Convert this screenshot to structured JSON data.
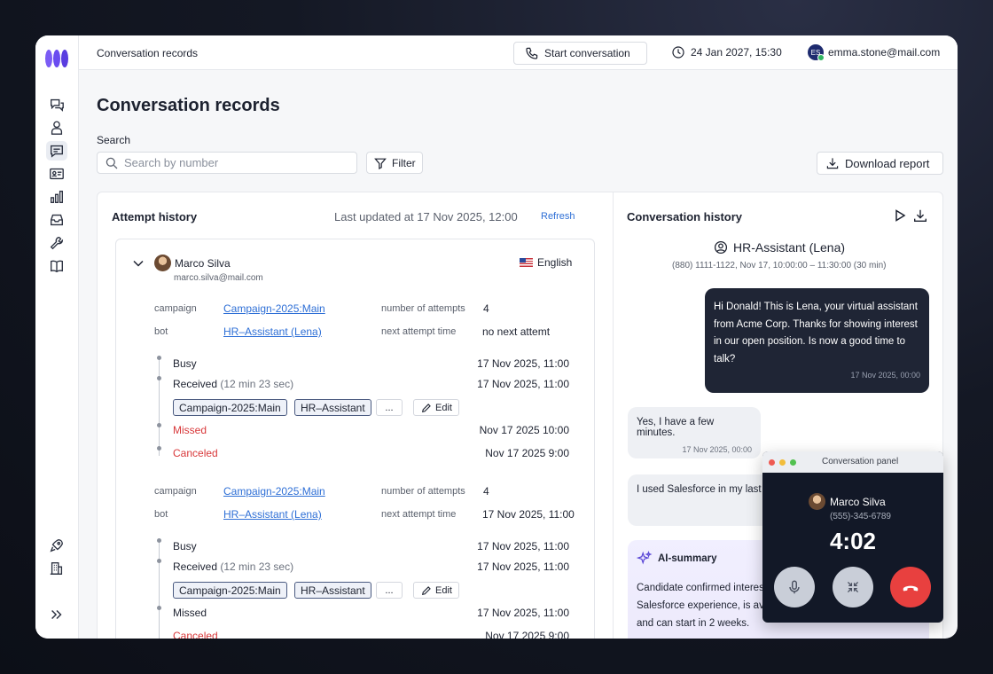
{
  "topbar": {
    "breadcrumb": "Conversation records",
    "start_conversation": "Start conversation",
    "datetime": "24 Jan 2027, 15:30",
    "user_initials": "ES",
    "user_email": "emma.stone@mail.com"
  },
  "page": {
    "title": "Conversation records",
    "search_label": "Search",
    "search_placeholder": "Search by number",
    "filter": "Filter",
    "download": "Download report"
  },
  "attempts": {
    "title": "Attempt history",
    "last_updated": "Last updated at 17 Nov 2025, 12:00",
    "refresh": "Refresh",
    "record": {
      "name": "Marco Silva",
      "email": "marco.silva@mail.com",
      "language": "English"
    },
    "labels": {
      "campaign": "campaign",
      "bot": "bot",
      "num_attempts": "number of attempts",
      "next_attempt": "next attempt time",
      "edit": "Edit",
      "more": "..."
    },
    "groups": [
      {
        "campaign": "Campaign-2025:Main",
        "bot": "HR–Assistant (Lena)",
        "attempts": "4",
        "next_attempt": "no next attemt",
        "events": [
          {
            "status": "Busy",
            "time": "17 Nov 2025, 11:00"
          },
          {
            "status": "Received",
            "duration": "(12 min 23 sec)",
            "time": "17 Nov 2025, 11:00"
          },
          {
            "status": "Missed",
            "time": "Nov 17 2025 10:00"
          },
          {
            "status": "Canceled",
            "time": "Nov 17 2025 9:00"
          }
        ],
        "tags": [
          "Campaign-2025:Main",
          "HR–Assistant"
        ]
      },
      {
        "campaign": "Campaign-2025:Main",
        "bot": "HR–Assistant (Lena)",
        "attempts": "4",
        "next_attempt": "17 Nov 2025, 11:00",
        "events": [
          {
            "status": "Busy",
            "time": "17 Nov 2025, 11:00"
          },
          {
            "status": "Received",
            "duration": "(12 min 23 sec)",
            "time": "17 Nov 2025, 11:00"
          },
          {
            "status": "Missed",
            "time": "17 Nov 2025, 11:00"
          },
          {
            "status": "Canceled",
            "time": "Nov 17 2025 9:00"
          }
        ],
        "tags": [
          "Campaign-2025:Main",
          "HR–Assistant"
        ]
      }
    ]
  },
  "conversation": {
    "title": "Conversation history",
    "bot_name": "HR-Assistant (Lena)",
    "bot_meta": "(880) 1111-1122, Nov 17, 10:00:00 – 11:30:00 (30 min)",
    "messages": [
      {
        "from": "bot",
        "text": "Hi Donald! This is Lena, your virtual assistant from Acme Corp. Thanks for showing interest in our open position. Is now a good time to talk?",
        "time": "17 Nov 2025, 00:00"
      },
      {
        "from": "user",
        "text": "Yes, I have a few minutes.",
        "time": "17 Nov 2025, 00:00"
      },
      {
        "from": "user",
        "text": "I used Salesforce in my last j"
      }
    ],
    "ai_summary_title": "AI-summary",
    "ai_summary_lines": [
      "Candidate confirmed interes",
      "Salesforce experience, is ava",
      "and can start in 2 weeks."
    ]
  },
  "call_panel": {
    "title": "Conversation panel",
    "name": "Marco Silva",
    "phone": "(555)-345-6789",
    "timer": "4:02"
  },
  "colors": {
    "accent": "#2e6fd6",
    "logo": "#6a4cf0",
    "bubble_dark": "#1f2535",
    "hangup": "#e8403f",
    "missed": "#d8383a"
  },
  "icons": [
    "chat-bubbles-icon",
    "user-icon",
    "message-icon",
    "contact-card-icon",
    "bar-chart-icon",
    "inbox-icon",
    "wrench-icon",
    "book-icon",
    "rocket-icon",
    "building-icon",
    "expand-icon"
  ]
}
